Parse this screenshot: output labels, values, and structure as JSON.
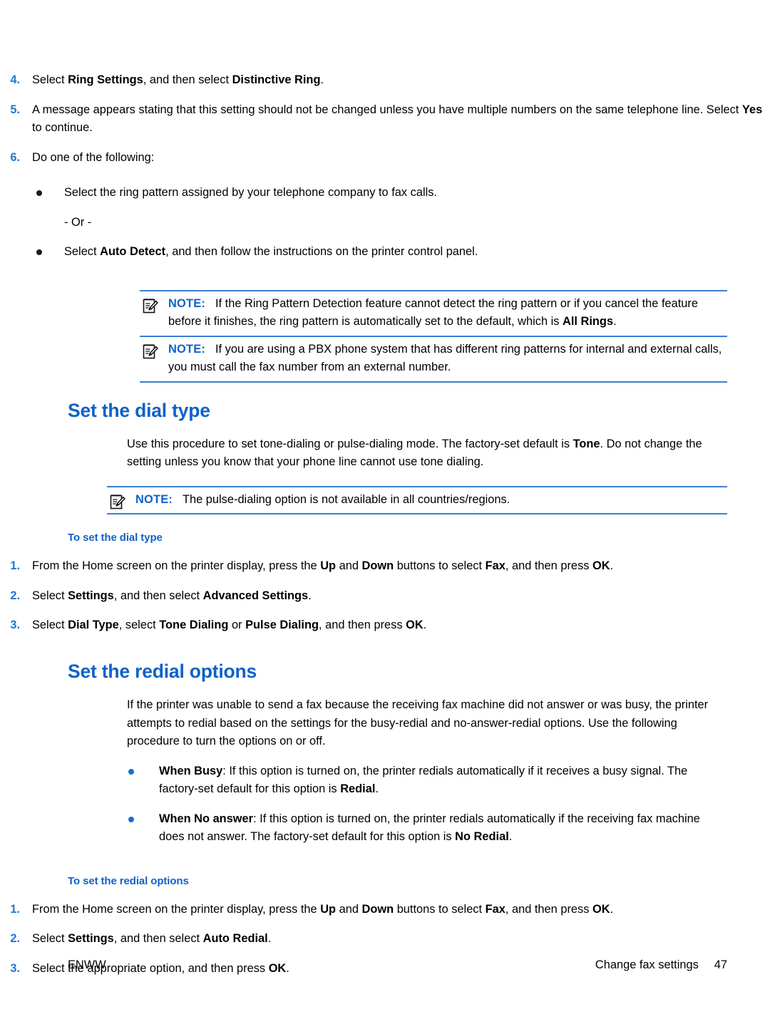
{
  "document": {
    "footer": {
      "left_label": "ENWW",
      "chapter_label": "Change fax settings",
      "page_number": "47"
    }
  },
  "colors": {
    "heading_blue": "#0f62c8",
    "rule_blue": "#3a7fd5",
    "list_number_blue": "#2277d4",
    "bullet_blue": "#1a6fd4",
    "body_black": "#000000"
  },
  "top_steps": [
    {
      "number": "4.",
      "parts": [
        {
          "t": "Select ",
          "b": false
        },
        {
          "t": "Ring Settings",
          "b": true
        },
        {
          "t": ", and then select ",
          "b": false
        },
        {
          "t": "Distinctive Ring",
          "b": true
        },
        {
          "t": ".",
          "b": false
        }
      ]
    },
    {
      "number": "5.",
      "parts": [
        {
          "t": "A message appears stating that this setting should not be changed unless you have multiple numbers on the same telephone line. Select ",
          "b": false
        },
        {
          "t": "Yes",
          "b": true
        },
        {
          "t": " to continue.",
          "b": false
        }
      ]
    },
    {
      "number": "6.",
      "parts": [
        {
          "t": "Do one of the following:",
          "b": false
        }
      ]
    }
  ],
  "step6_bullets": [
    {
      "kind": "bullet",
      "parts": [
        {
          "t": "Select the ring pattern assigned by your telephone company to fax calls.",
          "b": false
        }
      ]
    },
    {
      "kind": "plain",
      "parts": [
        {
          "t": "- Or -",
          "b": false
        }
      ]
    },
    {
      "kind": "bullet",
      "parts": [
        {
          "t": "Select ",
          "b": false
        },
        {
          "t": "Auto Detect",
          "b": true
        },
        {
          "t": ", and then follow the instructions on the printer control panel.",
          "b": false
        }
      ]
    }
  ],
  "notes_top": [
    {
      "label": "NOTE:",
      "icon": "note-pad-pencil-icon",
      "parts": [
        {
          "t": "If the Ring Pattern Detection feature cannot detect the ring pattern or if you cancel the feature before it finishes, the ring pattern is automatically set to the default, which is ",
          "b": false
        },
        {
          "t": "All Rings",
          "b": true
        },
        {
          "t": ".",
          "b": false
        }
      ]
    },
    {
      "label": "NOTE:",
      "icon": "note-pad-pencil-icon",
      "parts": [
        {
          "t": "If you are using a PBX phone system that has different ring patterns for internal and external calls, you must call the fax number from an external number.",
          "b": false
        }
      ]
    }
  ],
  "dial_type_section": {
    "title": "Set the dial type",
    "intro_parts": [
      {
        "t": "Use this procedure to set tone-dialing or pulse-dialing mode. The factory-set default is ",
        "b": false
      },
      {
        "t": "Tone",
        "b": true
      },
      {
        "t": ". Do not change the setting unless you know that your phone line cannot use tone dialing.",
        "b": false
      }
    ],
    "note": {
      "label": "NOTE:",
      "icon": "note-pad-pencil-icon",
      "parts": [
        {
          "t": "The pulse-dialing option is not available in all countries/regions.",
          "b": false
        }
      ]
    },
    "subtitle": "To set the dial type",
    "steps": [
      {
        "number": "1.",
        "parts": [
          {
            "t": "From the Home screen on the printer display, press the ",
            "b": false
          },
          {
            "t": "Up",
            "b": true
          },
          {
            "t": " and ",
            "b": false
          },
          {
            "t": "Down",
            "b": true
          },
          {
            "t": " buttons to select ",
            "b": false
          },
          {
            "t": "Fax",
            "b": true
          },
          {
            "t": ", and then press ",
            "b": false
          },
          {
            "t": "OK",
            "b": true
          },
          {
            "t": ".",
            "b": false
          }
        ]
      },
      {
        "number": "2.",
        "parts": [
          {
            "t": "Select ",
            "b": false
          },
          {
            "t": "Settings",
            "b": true
          },
          {
            "t": ", and then select ",
            "b": false
          },
          {
            "t": "Advanced Settings",
            "b": true
          },
          {
            "t": ".",
            "b": false
          }
        ]
      },
      {
        "number": "3.",
        "parts": [
          {
            "t": "Select ",
            "b": false
          },
          {
            "t": "Dial Type",
            "b": true
          },
          {
            "t": ", select ",
            "b": false
          },
          {
            "t": "Tone Dialing",
            "b": true
          },
          {
            "t": " or ",
            "b": false
          },
          {
            "t": "Pulse Dialing",
            "b": true
          },
          {
            "t": ", and then press ",
            "b": false
          },
          {
            "t": "OK",
            "b": true
          },
          {
            "t": ".",
            "b": false
          }
        ]
      }
    ]
  },
  "redial_section": {
    "title": "Set the redial options",
    "intro_parts": [
      {
        "t": "If the printer was unable to send a fax because the receiving fax machine did not answer or was busy, the printer attempts to redial based on the settings for the busy-redial and no-answer-redial options. Use the following procedure to turn the options on or off.",
        "b": false
      }
    ],
    "bullets": [
      {
        "parts": [
          {
            "t": "When Busy",
            "b": true
          },
          {
            "t": ": If this option is turned on, the printer redials automatically if it receives a busy signal. The factory-set default for this option is ",
            "b": false
          },
          {
            "t": "Redial",
            "b": true
          },
          {
            "t": ".",
            "b": false
          }
        ]
      },
      {
        "parts": [
          {
            "t": "When No answer",
            "b": true
          },
          {
            "t": ": If this option is turned on, the printer redials automatically if the receiving fax machine does not answer. The factory-set default for this option is ",
            "b": false
          },
          {
            "t": "No Redial",
            "b": true
          },
          {
            "t": ".",
            "b": false
          }
        ]
      }
    ],
    "subtitle": "To set the redial options",
    "steps": [
      {
        "number": "1.",
        "parts": [
          {
            "t": "From the Home screen on the printer display, press the ",
            "b": false
          },
          {
            "t": "Up",
            "b": true
          },
          {
            "t": " and ",
            "b": false
          },
          {
            "t": "Down",
            "b": true
          },
          {
            "t": " buttons to select ",
            "b": false
          },
          {
            "t": "Fax",
            "b": true
          },
          {
            "t": ", and then press ",
            "b": false
          },
          {
            "t": "OK",
            "b": true
          },
          {
            "t": ".",
            "b": false
          }
        ]
      },
      {
        "number": "2.",
        "parts": [
          {
            "t": "Select ",
            "b": false
          },
          {
            "t": "Settings",
            "b": true
          },
          {
            "t": ", and then select ",
            "b": false
          },
          {
            "t": "Auto Redial",
            "b": true
          },
          {
            "t": ".",
            "b": false
          }
        ]
      },
      {
        "number": "3.",
        "parts": [
          {
            "t": "Select the appropriate option, and then press ",
            "b": false
          },
          {
            "t": "OK",
            "b": true
          },
          {
            "t": ".",
            "b": false
          }
        ]
      }
    ]
  }
}
